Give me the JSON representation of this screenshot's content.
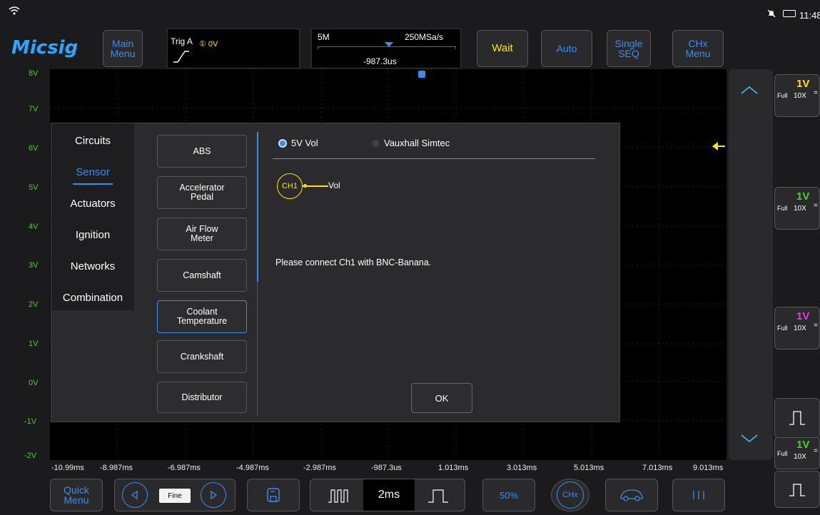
{
  "status": {
    "time": "11:48",
    "wifi_icon": "wifi-icon",
    "mute_icon": "bell-muted-icon",
    "battery_icon": "battery-icon"
  },
  "brand": {
    "logo": "Micsig"
  },
  "toolbar": {
    "main_menu": "Main\nMenu",
    "trigger": {
      "title": "Trig A",
      "level": "① 0V"
    },
    "timebase": {
      "memory": "5M",
      "sample_rate": "250MSa/s",
      "offset": "-987.3us"
    },
    "wait": "Wait",
    "auto": "Auto",
    "single_seq": "Single\nSEQ",
    "chx_menu": "CHx\nMenu"
  },
  "grid": {
    "v_labels": [
      "8V",
      "7V",
      "6V",
      "5V",
      "4V",
      "3V",
      "2V",
      "1V",
      "0V",
      "-1V",
      "-2V"
    ],
    "h_labels": [
      "-10.99ms",
      "-8.987ms",
      "-6.987ms",
      "-4.987ms",
      "-2.987ms",
      "-987.3us",
      "1.013ms",
      "3.013ms",
      "5.013ms",
      "7.013ms",
      "9.013ms"
    ]
  },
  "channels": [
    {
      "full": "Full",
      "volt": "1V",
      "probe": "10X",
      "color": "#ffe400"
    },
    {
      "full": "Full",
      "volt": "1V",
      "probe": "10X",
      "color": "#4ad12a"
    },
    {
      "full": "Full",
      "volt": "1V",
      "probe": "10X",
      "color": "#e23ae2"
    },
    {
      "full": "Full",
      "volt": "1V",
      "probe": "10X",
      "color": "#4ad12a"
    }
  ],
  "dialog": {
    "categories": [
      "Circuits",
      "Sensor",
      "Actuators",
      "Ignition",
      "Networks",
      "Combination"
    ],
    "active_category": "Sensor",
    "sensors": [
      "ABS",
      "Accelerator\nPedal",
      "Air Flow\nMeter",
      "Camshaft",
      "Coolant\nTemperature",
      "Crankshaft",
      "Distributor"
    ],
    "selected_sensor": "Coolant\nTemperature",
    "options": [
      {
        "label": "5V Vol",
        "selected": true
      },
      {
        "label": "Vauxhall Simtec",
        "selected": false
      }
    ],
    "ch_tag": "CH1",
    "ch_signal": "Vol",
    "instruction": "Please connect Ch1 with BNC-Banana.",
    "ok": "OK"
  },
  "bottom": {
    "quick_menu": "Quick\nMenu",
    "fine": "Fine",
    "timebase": "2ms",
    "percent": "50%",
    "chx": "CHx"
  },
  "colors": {
    "accent": "#3a8df0",
    "ch1": "#ffe400",
    "ch2": "#4ad12a"
  }
}
